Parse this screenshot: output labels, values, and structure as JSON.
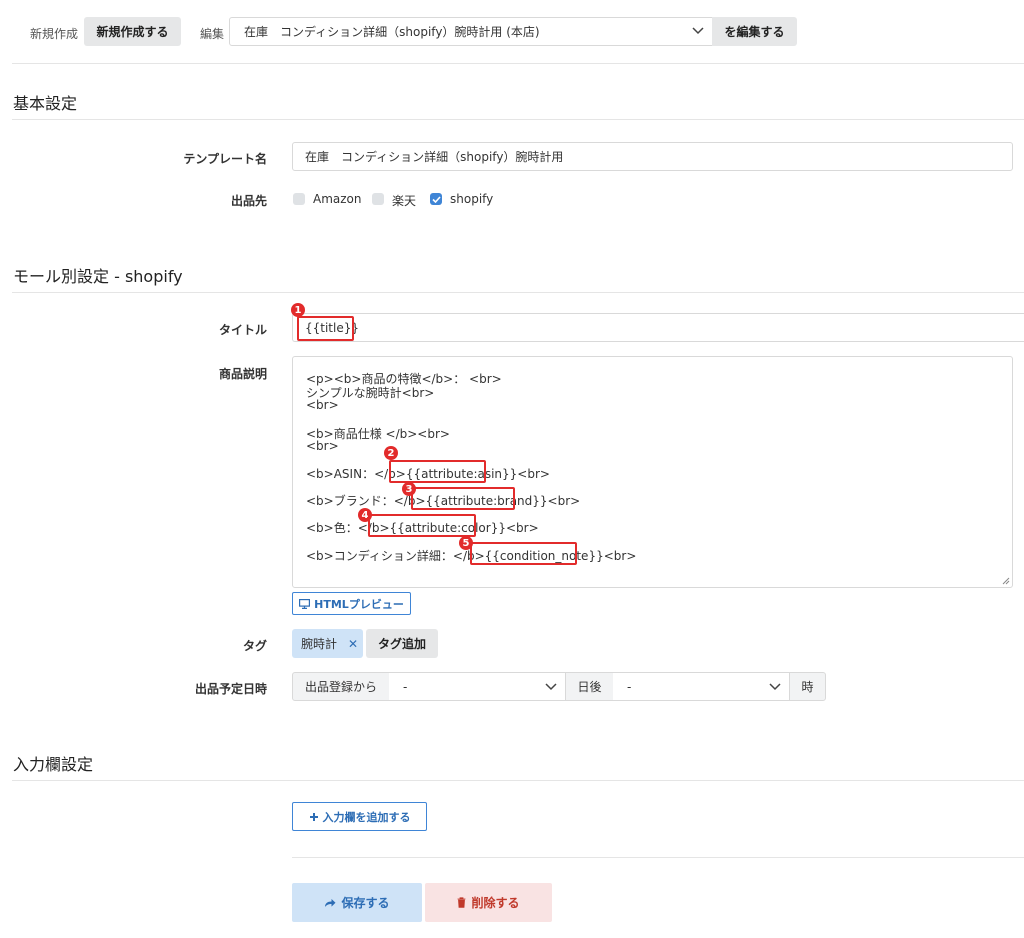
{
  "toolbar": {
    "new_label": "新規作成",
    "new_button": "新規作成する",
    "edit_label": "編集",
    "template_select": "在庫　コンディション詳細（shopify）腕時計用 (本店)",
    "edit_button": "を編集する"
  },
  "basic": {
    "section_title": "基本設定",
    "template_name_label": "テンプレート名",
    "template_name_value": "在庫　コンディション詳細（shopify）腕時計用",
    "destinations_label": "出品先",
    "destinations": [
      {
        "label": "Amazon",
        "checked": false
      },
      {
        "label": "楽天",
        "checked": false
      },
      {
        "label": "shopify",
        "checked": true
      }
    ]
  },
  "mall": {
    "section_title": "モール別設定 - shopify",
    "title_label": "タイトル",
    "title_value": "{{title}}",
    "description_label": "商品説明",
    "description_lines": [
      "<p><b>商品の特徴</b>： <br>",
      "シンプルな腕時計<br>",
      "<br>",
      "<b>商品仕様 </b><br>",
      "<br>",
      "<b>ASIN：</b>{{attribute:asin}}<br>",
      "<b>ブランド：</b>{{attribute:brand}}<br>",
      "<b>色：</b>{{attribute:color}}<br>",
      "<b>コンディション詳細：</b>{{condition_note}}<br>"
    ],
    "html_preview_button": "HTMLプレビュー",
    "tags_label": "タグ",
    "tag_chip": "腕時計",
    "tag_remove": "✕",
    "tag_add_button": "タグ追加",
    "schedule_label": "出品予定日時",
    "schedule_prefix": "出品登録から",
    "schedule_days_value": "-",
    "schedule_days_suffix": "日後",
    "schedule_hour_value": "-",
    "schedule_hour_suffix": "時"
  },
  "annotations": [
    "1",
    "2",
    "3",
    "4",
    "5"
  ],
  "input_fields": {
    "section_title": "入力欄設定",
    "add_button": "入力欄を追加する"
  },
  "actions": {
    "save_button": "保存する",
    "delete_button": "削除する"
  },
  "colors": {
    "accent_red": "#e22b2b",
    "primary_blue": "#3f85d6",
    "save_bg": "#cfe3f7",
    "delete_bg": "#f9e3e3"
  }
}
